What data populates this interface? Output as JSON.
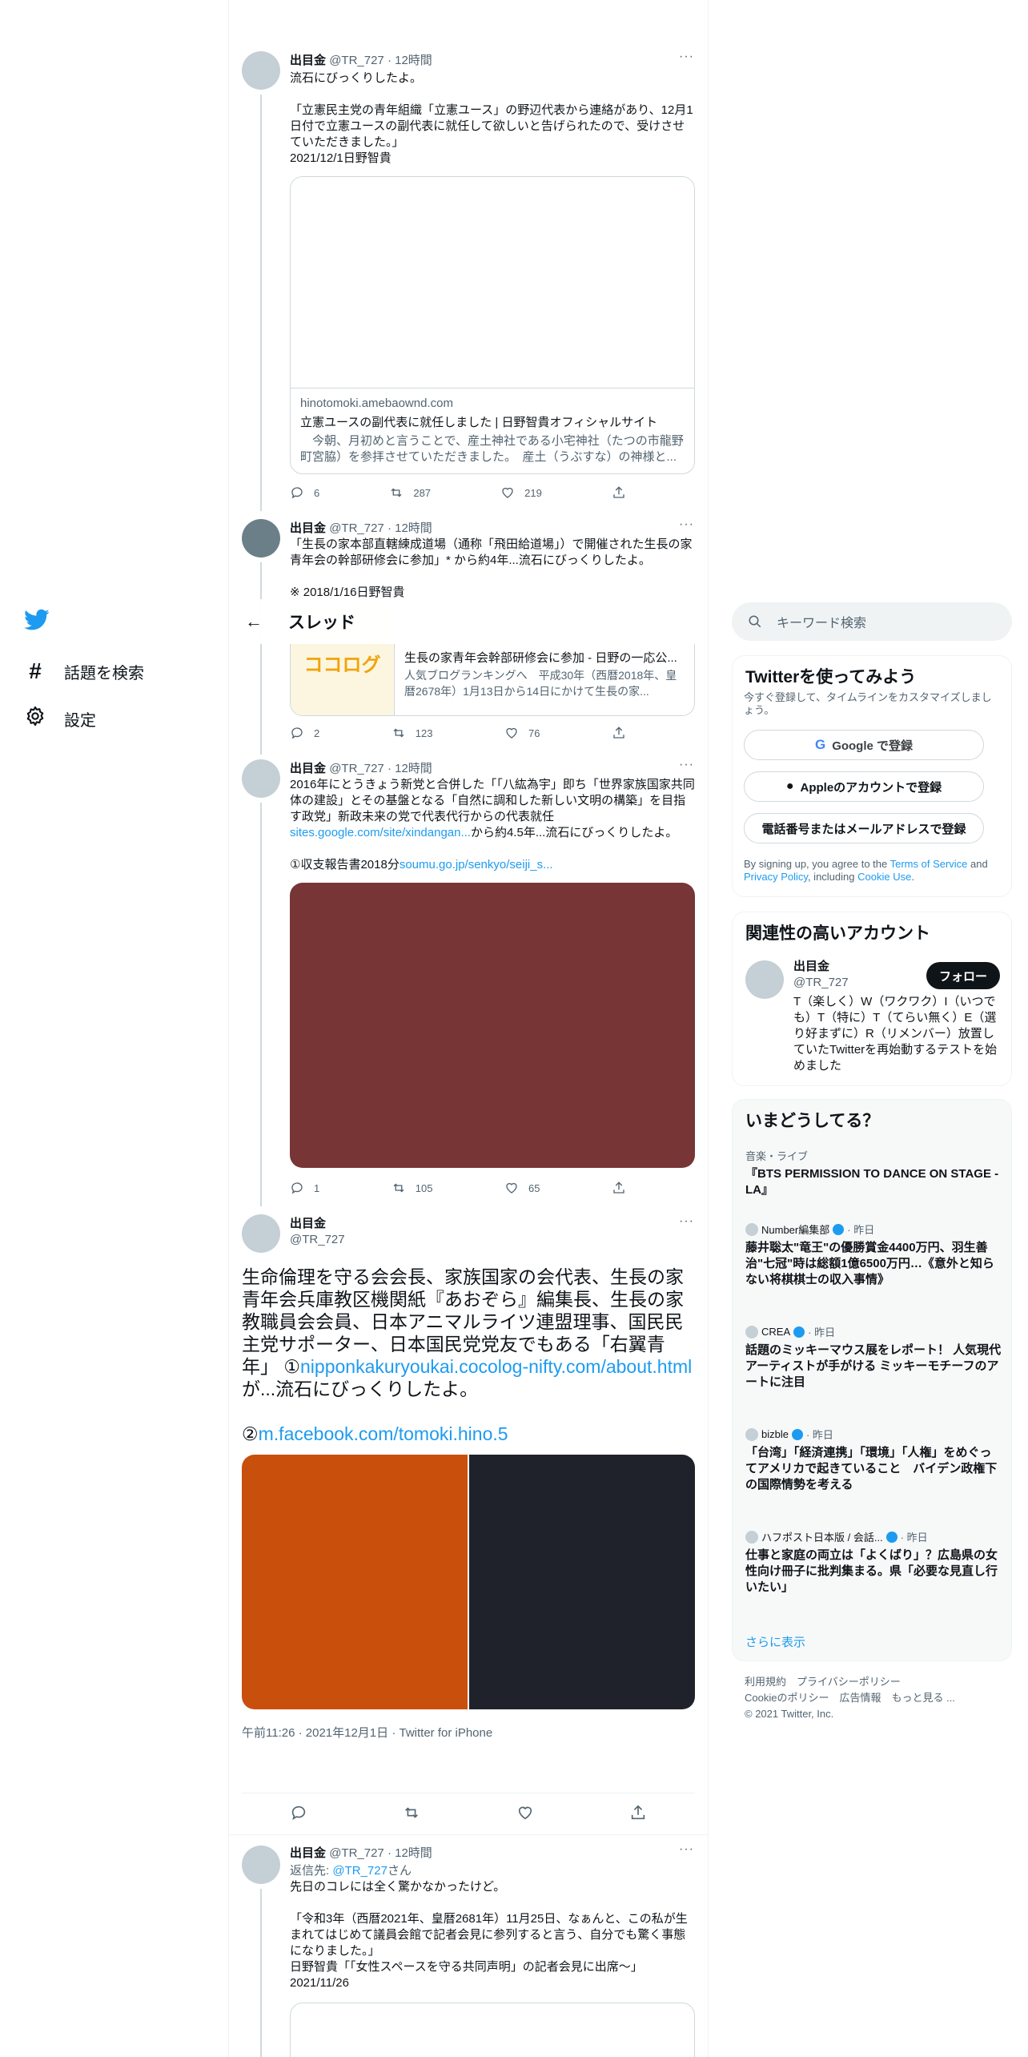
{
  "nav": {
    "explore_label": "話題を検索",
    "settings_label": "設定"
  },
  "header": {
    "title": "スレッド"
  },
  "search": {
    "placeholder": "キーワード検索"
  },
  "tweet1": {
    "name": "出目金",
    "handle": "@TR_727",
    "time": "· 12時間",
    "text": "流石にびっくりしたよ。\n\n「立憲民主党の青年組織「立憲ユース」の野辺代表から連絡があり、12月1日付で立憲ユースの副代表に就任して欲しいと告げられたので、受けさせていただきました。」\n2021/12/1日野智貴",
    "card": {
      "domain": "hinotomoki.amebaownd.com",
      "title": "立憲ユースの副代表に就任しました | 日野智貴オフィシャルサイト",
      "desc": "　今朝、月初めと言うことで、産土神社である小宅神社（たつの市龍野町宮脇）を参拝させていただきました。　産土（うぶすな）の神様と..."
    },
    "replies": "6",
    "retweets": "287",
    "likes": "219"
  },
  "tweet2": {
    "name": "出目金",
    "handle": "@TR_727",
    "time": "· 12時間",
    "text": "「生長の家本部直轄練成道場（通称「飛田給道場」）で開催された生長の家青年会の幹部研修会に参加」* から約4年...流石にびっくりしたよ。\n\n※ 2018/1/16日野智貴",
    "card": {
      "logo": "ココログ",
      "title": "生長の家青年会幹部研修会に参加 - 日野の一応公...",
      "desc": "人気ブログランキングへ　平成30年（西暦2018年、皇暦2678年）1月13日から14日にかけて生長の家..."
    },
    "replies": "2",
    "retweets": "123",
    "likes": "76"
  },
  "tweet3": {
    "name": "出目金",
    "handle": "@TR_727",
    "time": "· 12時間",
    "text_a": "2016年にとうきょう新党と合併した「「八紘為宇」即ち「世界家族国家共同体の建設」とその基盤となる「自然に調和した新しい文明の構築」を目指す政党」新政未来の党で代表代行からの代表就任",
    "link_a": "sites.google.com/site/xindangan...",
    "text_b": "から約4.5年...流石にびっくりしたよ。",
    "text_c": "①収支報告書2018分",
    "link_c": "soumu.go.jp/senkyo/seiji_s...",
    "replies": "1",
    "retweets": "105",
    "likes": "65",
    "image_color": "#773535"
  },
  "main_tweet": {
    "name": "出目金",
    "handle": "@TR_727",
    "text_a": "生命倫理を守る会会長、家族国家の会代表、生長の家青年会兵庫教区機関紙『あおぞら』編集長、生長の家教職員会会員、日本アニマルライツ連盟理事、国民民主党サポーター、日本国民党党友でもある「右翼青年」 ①",
    "link_a": "nipponkakuryoukai.cocolog-nifty.com/about.html",
    "text_b": "が...流石にびっくりしたよ。",
    "text_c": "②",
    "link_c": "m.facebook.com/tomoki.hino.5",
    "timestamp": "午前11:26 · 2021年12月1日 · Twitter for iPhone",
    "image_colors": [
      "#c94f0c",
      "#1f222a"
    ]
  },
  "tweet4": {
    "name": "出目金",
    "handle": "@TR_727",
    "time": "· 12時間",
    "reply_prefix": "返信先: ",
    "reply_to": "@TR_727",
    "reply_suffix": "さん",
    "text": "先日のコレには全く驚かなかったけど。\n\n「令和3年（西暦2021年、皇暦2681年）11月25日、なぁんと、この私が生まれてはじめて議員会館で記者会見に参列すると言う、自分でも驚く事態になりました。」\n日野智貴「「女性スペースを守る共同声明」の記者会見に出席〜」\n2021/11/26"
  },
  "signup": {
    "title": "Twitterを使ってみよう",
    "subtitle": "今すぐ登録して、タイムラインをカスタマイズしましょう。",
    "google": "Google で登録",
    "apple": "Appleのアカウントで登録",
    "phone": "電話番号またはメールアドレスで登録",
    "terms_a": "By signing up, you agree to the ",
    "terms_link1": "Terms of Service",
    "terms_b": " and ",
    "terms_link2": "Privacy Policy",
    "terms_c": ", including ",
    "terms_link3": "Cookie Use",
    "terms_d": "."
  },
  "related": {
    "title": "関連性の高いアカウント",
    "name": "出目金",
    "handle": "@TR_727",
    "follow": "フォロー",
    "bio": "T（楽しく）W（ワクワク）I（いつでも）T（特に）T（てらい無く）E（選り好まずに）R（リメンバー）放置していたTwitterを再始動するテストを始めました"
  },
  "trends": {
    "title": "いまどうしてる？",
    "items": [
      {
        "meta": "音楽・ライブ",
        "title": "『BTS PERMISSION TO DANCE ON STAGE - LA』"
      },
      {
        "meta": "Number編集部",
        "when": "· 昨日",
        "title": "藤井聡太\"竜王\"の優勝賞金4400万円、羽生善治\"七冠\"時は総額1億6500万円…《意外と知らない将棋棋士の収入事情》"
      },
      {
        "meta": "CREA",
        "when": "· 昨日",
        "title": "話題のミッキーマウス展をレポート！ 人気現代アーティストが手がける ミッキーモチーフのアートに注目"
      },
      {
        "meta": "bizble",
        "when": "· 昨日",
        "title": "「台湾」「経済連携」「環境」「人権」をめぐってアメリカで起きていること　バイデン政権下の国際情勢を考える"
      },
      {
        "meta": "ハフポスト日本版 / 会話...",
        "when": "· 昨日",
        "title": "仕事と家庭の両立は「よくばり」？広島県の女性向け冊子に批判集まる。県「必要な見直し行いたい」"
      }
    ],
    "more": "さらに表示"
  },
  "footer": {
    "line1": "利用規約　プライバシーポリシー",
    "line2": "Cookieのポリシー　広告情報　もっと見る ...",
    "line3": "© 2021 Twitter, Inc."
  }
}
